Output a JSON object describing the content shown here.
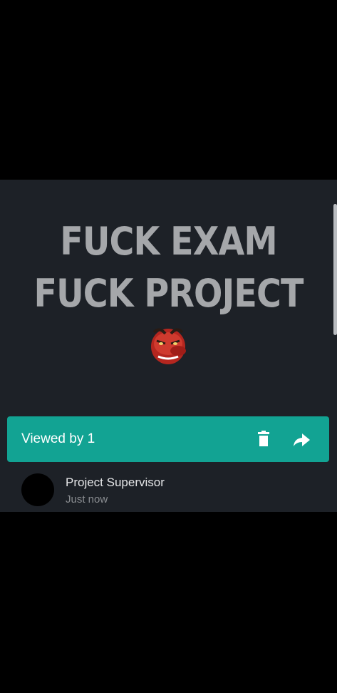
{
  "story": {
    "line1": "FUCK EXAM",
    "line2": "FUCK PROJECT",
    "emoji": "goblin-mask-icon"
  },
  "viewed_bar": {
    "label": "Viewed by 1",
    "icons": [
      "delete-icon",
      "forward-icon"
    ],
    "color": "#12a393"
  },
  "viewers": [
    {
      "name": "Project Supervisor",
      "time": "Just now"
    }
  ]
}
